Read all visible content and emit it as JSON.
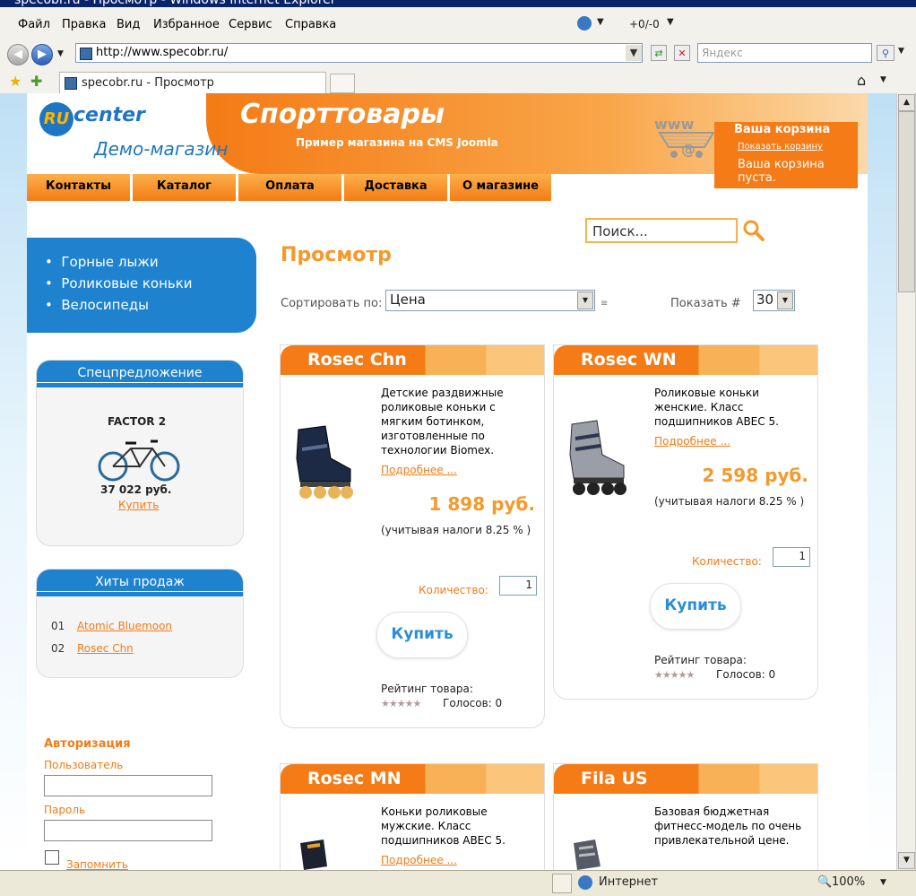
{
  "window": {
    "title": "specobr.ru - Просмотр - Windows Internet Explorer"
  },
  "menu": [
    "Файл",
    "Правка",
    "Вид",
    "Избранное",
    "Сервис",
    "Справка"
  ],
  "toolbar_counter": "+0/-0",
  "address": {
    "url": "http://www.specobr.ru/",
    "search_placeholder": "Яндекс"
  },
  "tab": {
    "title": "specobr.ru - Просмотр"
  },
  "site": {
    "logo_ru": "RU",
    "logo_center": "center",
    "logo_demo": "Демо-магазин",
    "title": "Спорттовары",
    "subtitle": "Пример магазина на CMS Joomla",
    "cart_logo_text": "www",
    "nav": [
      "Контакты",
      "Каталог",
      "Оплата",
      "Доставка",
      "О магазине"
    ]
  },
  "cart": {
    "title": "Ваша корзина",
    "show_link": "Показать корзину",
    "empty_text": "Ваша корзина пуста."
  },
  "search": {
    "placeholder": "Поиск..."
  },
  "categories": [
    "Горные лыжи",
    "Роликовые коньки",
    "Велосипеды"
  ],
  "special": {
    "title": "Спецпредложение",
    "name": "FACTOR 2",
    "price": "37 022 руб.",
    "buy": "Купить"
  },
  "hits": {
    "title": "Хиты продаж",
    "items": [
      {
        "num": "01",
        "name": "Atomic Bluemoon"
      },
      {
        "num": "02",
        "name": "Rosec Chn"
      }
    ]
  },
  "auth": {
    "title": "Авторизация",
    "user_label": "Пользователь",
    "pass_label": "Пароль",
    "remember": "Запомнить"
  },
  "main": {
    "heading": "Просмотр",
    "sort_label": "Сортировать по:",
    "sort_value": "Цена",
    "show_label": "Показать #",
    "show_value": "30"
  },
  "products": [
    {
      "title": "Rosec Chn",
      "desc": "Детские раздвижные роликовые коньки с мягким ботинком, изготовленные по технологии Biomex.",
      "more": "Подробнее ...",
      "price": "1 898 руб.",
      "tax": "(учитывая налоги 8.25 % )",
      "qty_label": "Количество:",
      "qty": "1",
      "buy": "Купить",
      "rating_label": "Рейтинг товара:",
      "votes": "Голосов: 0"
    },
    {
      "title": "Rosec WN",
      "desc": "Роликовые коньки женские. Класс подшипников ABEC 5.",
      "more": "Подробнее ...",
      "price": "2 598 руб.",
      "tax": "(учитывая налоги 8.25 % )",
      "qty_label": "Количество:",
      "qty": "1",
      "buy": "Купить",
      "rating_label": "Рейтинг товара:",
      "votes": "Голосов: 0"
    },
    {
      "title": "Rosec MN",
      "desc": "Коньки роликовые мужские. Класс подшипников ABEC 5.",
      "more": "Подробнее ..."
    },
    {
      "title": "Fila US",
      "desc": "Базовая бюджетная фитнесс-модель по очень привлекательной цене."
    }
  ],
  "status": {
    "zone": "Интернет",
    "zoom": "100%"
  },
  "colors": {
    "accent": "#f47b16",
    "blue": "#1e82cf",
    "link_orange": "#f47b16",
    "buy_blue": "#2a8fd6"
  }
}
